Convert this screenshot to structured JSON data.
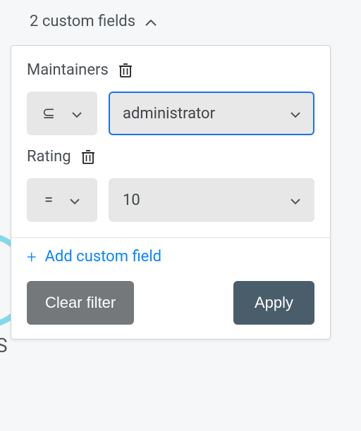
{
  "toggle": {
    "label": "2 custom fields"
  },
  "filters": [
    {
      "id": "maintainers",
      "label": "Maintainers",
      "op_symbol": "⊆",
      "value": "administrator",
      "value_focused": true
    },
    {
      "id": "rating",
      "label": "Rating",
      "op_symbol": "=",
      "value": "10",
      "value_focused": false
    }
  ],
  "addLabel": "Add custom field",
  "buttons": {
    "clear": "Clear filter",
    "apply": "Apply"
  },
  "colors": {
    "link": "#0a84ff",
    "focus": "#1a73e8",
    "btnSecondary": "#75787b",
    "btnPrimary": "#4a5d6b"
  }
}
